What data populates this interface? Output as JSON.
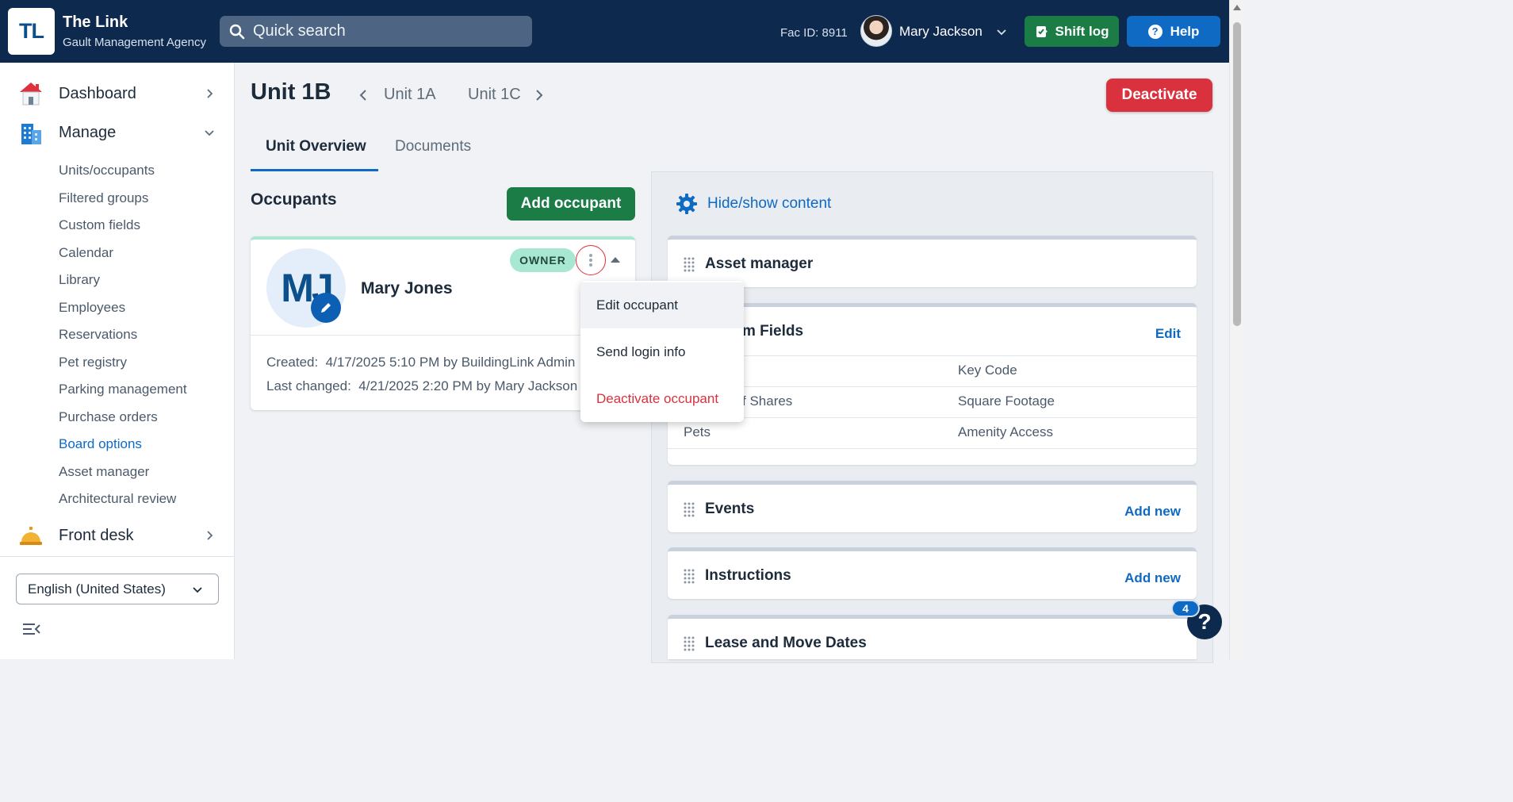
{
  "header": {
    "logo_text": "TL",
    "app_title": "The Link",
    "agency": "Gault Management Agency",
    "search_placeholder": "Quick search",
    "fac_id": "Fac ID: 8911",
    "user_name": "Mary Jackson",
    "shift_log": "Shift log",
    "help": "Help"
  },
  "sidebar": {
    "dashboard": "Dashboard",
    "manage": "Manage",
    "manage_items": [
      "Units/occupants",
      "Filtered groups",
      "Custom fields",
      "Calendar",
      "Library",
      "Employees",
      "Reservations",
      "Pet registry",
      "Parking management",
      "Purchase orders",
      "Board options",
      "Asset manager",
      "Architectural review"
    ],
    "active_item": "Board options",
    "front_desk": "Front desk",
    "language": "English (United States)"
  },
  "unit": {
    "title": "Unit 1B",
    "prev": "Unit 1A",
    "next": "Unit 1C",
    "deactivate": "Deactivate"
  },
  "tabs": {
    "overview": "Unit Overview",
    "documents": "Documents"
  },
  "occupants": {
    "title": "Occupants",
    "add_button": "Add occupant",
    "card": {
      "initials": "MJ",
      "name": "Mary Jones",
      "badge": "OWNER",
      "created_label": "Created:",
      "created_value": "4/17/2025 5:10 PM by BuildingLink Admin",
      "changed_label": "Last changed:",
      "changed_value": "4/21/2025 2:20 PM by Mary Jackson"
    },
    "menu": {
      "edit": "Edit occupant",
      "send_login": "Send login info",
      "deactivate": "Deactivate occupant"
    }
  },
  "right_panel": {
    "hide_show": "Hide/show content",
    "asset_manager": "Asset manager",
    "custom_fields": {
      "title_visible": "m Fields",
      "edit": "Edit",
      "rows": [
        {
          "left": "",
          "right": "Key Code"
        },
        {
          "left": "f Shares",
          "right": "Square Footage"
        },
        {
          "left": "Pets",
          "right": "Amenity Access"
        }
      ]
    },
    "events": {
      "title": "Events",
      "link": "Add new"
    },
    "instructions": {
      "title": "Instructions",
      "link": "Add new"
    },
    "lease": {
      "title": "Lease and Move Dates"
    }
  },
  "help_fab": {
    "symbol": "?",
    "badge": "4"
  },
  "colors": {
    "topbar": "#0d2a4e",
    "primary_blue": "#0e6ac3",
    "green": "#1b7c46",
    "danger": "#d9313d",
    "owner_badge": "#a8e7d1"
  }
}
